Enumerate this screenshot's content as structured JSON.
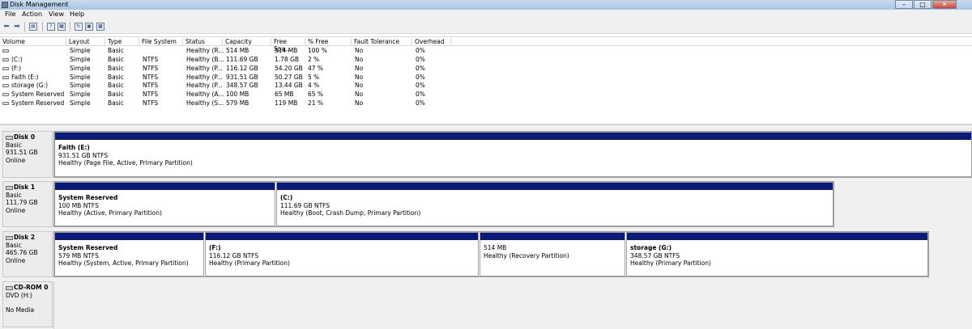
{
  "window": {
    "title": "Disk Management"
  },
  "menu": [
    "File",
    "Action",
    "View",
    "Help"
  ],
  "toolbar": {
    "icons": [
      "back-arrow-icon",
      "forward-arrow-icon",
      "console-tree-icon",
      "help-icon",
      "properties-icon",
      "refresh-icon",
      "rescan-icon",
      "settings-icon"
    ]
  },
  "columns": [
    "Volume",
    "Layout",
    "Type",
    "File System",
    "Status",
    "Capacity",
    "Free Spa...",
    "% Free",
    "Fault Tolerance",
    "Overhead"
  ],
  "volumes": [
    {
      "volume": "",
      "layout": "Simple",
      "type": "Basic",
      "fs": "",
      "status": "Healthy (R...",
      "capacity": "514 MB",
      "free": "514 MB",
      "pct": "100 %",
      "fault": "No",
      "overhead": "0%"
    },
    {
      "volume": "(C:)",
      "layout": "Simple",
      "type": "Basic",
      "fs": "NTFS",
      "status": "Healthy (B...",
      "capacity": "111.69 GB",
      "free": "1.78 GB",
      "pct": "2 %",
      "fault": "No",
      "overhead": "0%"
    },
    {
      "volume": "(F:)",
      "layout": "Simple",
      "type": "Basic",
      "fs": "NTFS",
      "status": "Healthy (P...",
      "capacity": "116.12 GB",
      "free": "54.20 GB",
      "pct": "47 %",
      "fault": "No",
      "overhead": "0%"
    },
    {
      "volume": "Faith (E:)",
      "layout": "Simple",
      "type": "Basic",
      "fs": "NTFS",
      "status": "Healthy (P...",
      "capacity": "931.51 GB",
      "free": "50.27 GB",
      "pct": "5 %",
      "fault": "No",
      "overhead": "0%"
    },
    {
      "volume": "storage (G:)",
      "layout": "Simple",
      "type": "Basic",
      "fs": "NTFS",
      "status": "Healthy (P...",
      "capacity": "348.57 GB",
      "free": "13.44 GB",
      "pct": "4 %",
      "fault": "No",
      "overhead": "0%"
    },
    {
      "volume": "System Reserved",
      "layout": "Simple",
      "type": "Basic",
      "fs": "NTFS",
      "status": "Healthy (A...",
      "capacity": "100 MB",
      "free": "65 MB",
      "pct": "65 %",
      "fault": "No",
      "overhead": "0%"
    },
    {
      "volume": "System Reserved",
      "layout": "Simple",
      "type": "Basic",
      "fs": "NTFS",
      "status": "Healthy (S...",
      "capacity": "579 MB",
      "free": "119 MB",
      "pct": "21 %",
      "fault": "No",
      "overhead": "0%"
    }
  ],
  "disks": [
    {
      "name": "Disk 0",
      "kind": "Basic",
      "size": "931.51 GB",
      "state": "Online",
      "partitions": [
        {
          "name": "Faith  (E:)",
          "size": "931.51 GB NTFS",
          "status": "Healthy (Page File, Active, Primary Partition)"
        }
      ]
    },
    {
      "name": "Disk 1",
      "kind": "Basic",
      "size": "111.79 GB",
      "state": "Online",
      "partitions": [
        {
          "name": "System Reserved",
          "size": "100 MB NTFS",
          "status": "Healthy (Active, Primary Partition)"
        },
        {
          "name": "(C:)",
          "size": "111.69 GB NTFS",
          "status": "Healthy (Boot, Crash Dump, Primary Partition)"
        }
      ]
    },
    {
      "name": "Disk 2",
      "kind": "Basic",
      "size": "465.76 GB",
      "state": "Online",
      "partitions": [
        {
          "name": "System Reserved",
          "size": "579 MB NTFS",
          "status": "Healthy (System, Active, Primary Partition)"
        },
        {
          "name": "(F:)",
          "size": "116.12 GB NTFS",
          "status": "Healthy (Primary Partition)"
        },
        {
          "name": "",
          "size": "514 MB",
          "status": "Healthy (Recovery Partition)"
        },
        {
          "name": "storage  (G:)",
          "size": "348.57 GB NTFS",
          "status": "Healthy (Primary Partition)"
        }
      ]
    }
  ],
  "cdrom": {
    "name": "CD-ROM 0",
    "drive": "DVD (H:)",
    "media": "No Media"
  },
  "colors": {
    "partition_bar": "#0a1a7a",
    "titlebar": "#a9c4e2",
    "background": "#f0f0f0"
  }
}
